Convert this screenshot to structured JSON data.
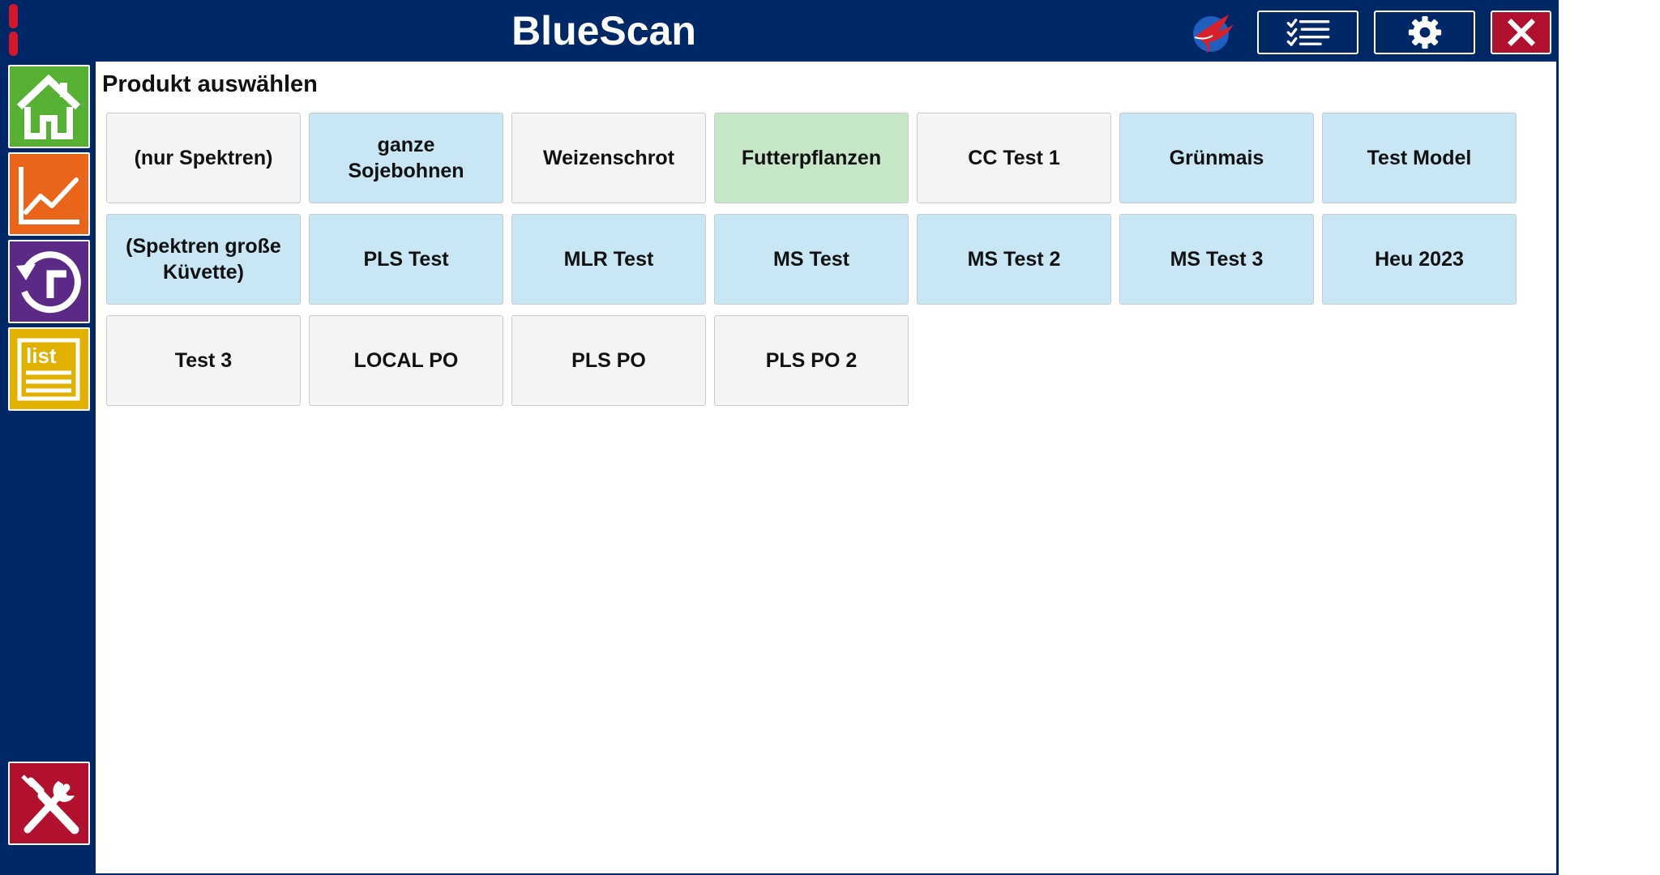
{
  "app": {
    "title": "BlueScan"
  },
  "header": {
    "buttons": {
      "checklist": "checklist-icon",
      "settings": "gear-icon",
      "close": "close-icon"
    },
    "logo": "bird-logo-icon"
  },
  "sidebar": {
    "items": [
      {
        "name": "home",
        "icon": "home-icon",
        "color": "#56b033"
      },
      {
        "name": "chart",
        "icon": "line-chart-icon",
        "color": "#ea6519"
      },
      {
        "name": "history",
        "icon": "history-icon",
        "color": "#5a2a86"
      },
      {
        "name": "list",
        "icon": "list-icon",
        "label": "list",
        "color": "#e2b100"
      },
      {
        "name": "tools",
        "icon": "tools-icon",
        "color": "#b2102f"
      }
    ]
  },
  "main": {
    "title": "Produkt auswählen",
    "products": [
      {
        "label": "(nur Spektren)",
        "color": "gray"
      },
      {
        "label": "ganze\nSojebohnen",
        "color": "blue"
      },
      {
        "label": "Weizenschrot",
        "color": "gray"
      },
      {
        "label": "Futterpflanzen",
        "color": "green"
      },
      {
        "label": "CC Test 1",
        "color": "gray"
      },
      {
        "label": "Grünmais",
        "color": "blue"
      },
      {
        "label": "Test Model",
        "color": "blue"
      },
      {
        "label": "(Spektren große\nKüvette)",
        "color": "blue"
      },
      {
        "label": "PLS Test",
        "color": "blue"
      },
      {
        "label": "MLR Test",
        "color": "blue"
      },
      {
        "label": "MS Test",
        "color": "blue"
      },
      {
        "label": "MS Test 2",
        "color": "blue"
      },
      {
        "label": "MS Test 3",
        "color": "blue"
      },
      {
        "label": "Heu 2023",
        "color": "blue"
      },
      {
        "label": "Test 3",
        "color": "gray"
      },
      {
        "label": "LOCAL PO",
        "color": "gray"
      },
      {
        "label": "PLS PO",
        "color": "gray"
      },
      {
        "label": "PLS PO 2",
        "color": "gray"
      }
    ]
  },
  "colors": {
    "background": "#002766",
    "tile_gray": "#f4f4f4",
    "tile_blue": "#c9e6f5",
    "tile_green": "#c6e6c8",
    "accent_red": "#b2102f"
  }
}
